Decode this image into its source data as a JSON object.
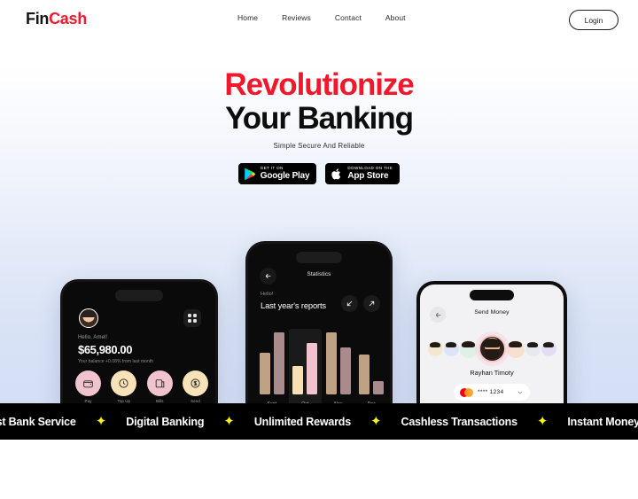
{
  "brand": {
    "name_first": "Fin",
    "name_accent": "Cash"
  },
  "nav": {
    "links": [
      {
        "label": "Home"
      },
      {
        "label": "Reviews"
      },
      {
        "label": "Contact"
      },
      {
        "label": "About"
      }
    ],
    "login_label": "Login"
  },
  "hero": {
    "line1": "Revolutionize",
    "line2": "Your Banking",
    "subtitle": "Simple Secure And Reliable",
    "accent_color": "#f2182c"
  },
  "badges": [
    {
      "name": "google-play",
      "top": "GET IT ON",
      "bottom": "Google Play"
    },
    {
      "name": "app-store",
      "top": "Download on the",
      "bottom": "App Store"
    }
  ],
  "phone_left": {
    "greeting": "Hello, Amel!",
    "balance": "$65,980.00",
    "note": "Your balance +0.08% from last month",
    "actions": [
      {
        "icon": "wallet-icon",
        "label": "Pay",
        "color": "#f0c3ce"
      },
      {
        "icon": "clock-icon",
        "label": "Top Up",
        "color": "#f8e3b8"
      },
      {
        "icon": "card-icon",
        "label": "Bills",
        "color": "#f0c3ce"
      },
      {
        "icon": "dollar-icon",
        "label": "Send",
        "color": "#f8e3b8"
      }
    ]
  },
  "phone_center": {
    "title": "Statistics",
    "greeting": "Hello!",
    "heading": "Last year's reports",
    "back_icon": "arrow-left-icon",
    "action_icons": [
      "arrow-down-left-icon",
      "arrow-up-right-icon"
    ]
  },
  "phone_right": {
    "title": "Send Money",
    "back_icon": "arrow-left-icon",
    "recipient": "Rayhan Timoty",
    "card_brand": "mastercard-icon",
    "card_number": "**** 1234",
    "chevron": "chevron-down-icon"
  },
  "marquee": {
    "items": [
      "Best Bank Service",
      "Digital Banking",
      "Unlimited Rewards",
      "Cashless Transactions",
      "Instant Money Transfer"
    ],
    "separator": "✦",
    "star_color": "#fbf40d",
    "background": "#000000"
  },
  "chart_data": {
    "type": "bar",
    "title": "Last year's reports",
    "categories": [
      "Sept",
      "Oct",
      "Nov",
      "Dec"
    ],
    "xlabel": "",
    "ylabel": "",
    "ylim": [
      0,
      100
    ],
    "grid": false,
    "legend": "none",
    "series": [
      {
        "name": "Series A",
        "values": [
          55,
          38,
          82,
          53
        ],
        "color": "#bfa183"
      },
      {
        "name": "Series B",
        "values": [
          82,
          68,
          62,
          18
        ],
        "color": "#a98a8d"
      }
    ],
    "highlight_category": "Oct",
    "highlight_colors": {
      "Series A": "#f7e0b4",
      "Series B": "#f3c2ce"
    }
  }
}
